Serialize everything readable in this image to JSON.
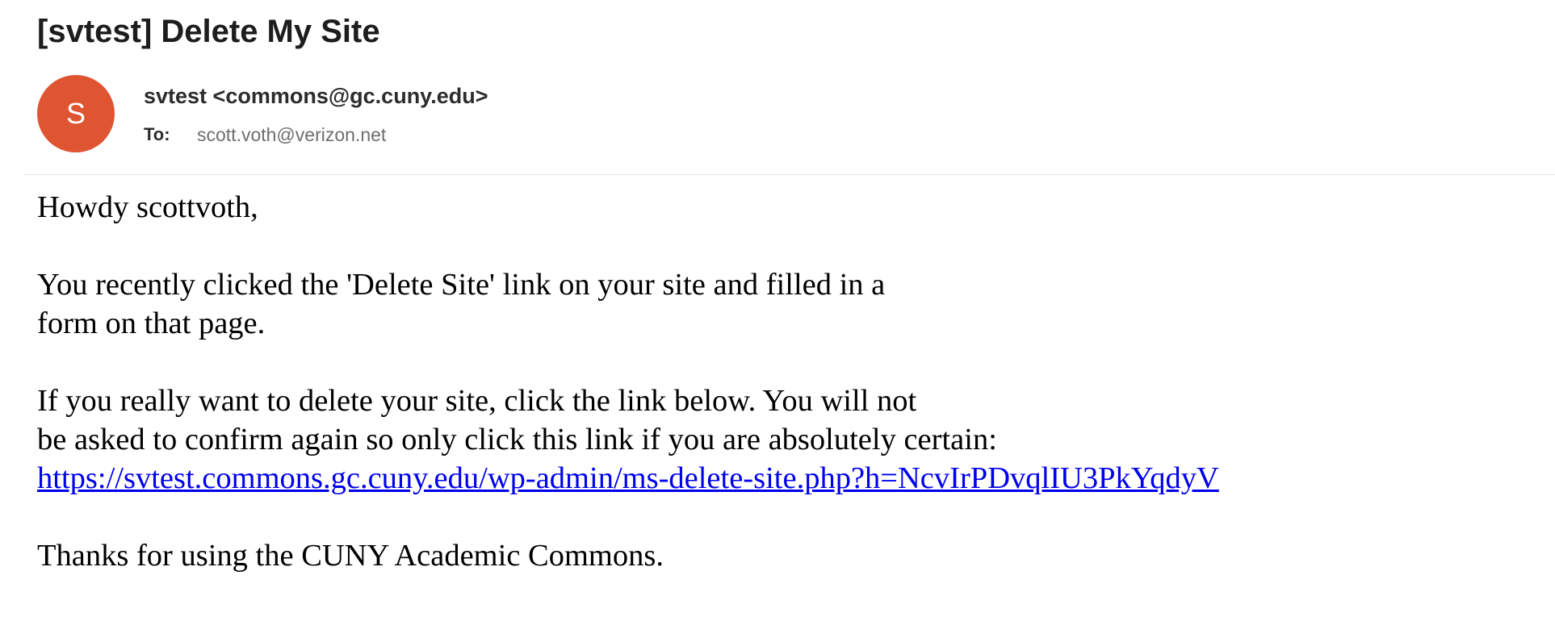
{
  "email": {
    "subject": "[svtest] Delete My Site",
    "avatar": {
      "letter": "S",
      "color": "#df5531"
    },
    "sender": "svtest <commons@gc.cuny.edu>",
    "to_label": "To:",
    "to_address": "scott.voth@verizon.net",
    "body": {
      "greeting": "Howdy scottvoth,",
      "paragraph1_line1": "You recently clicked the 'Delete Site' link on your site and filled in a",
      "paragraph1_line2": "form on that page.",
      "paragraph2_line1": "If you really want to delete your site, click the link below. You will not",
      "paragraph2_line2": "be asked to confirm again so only click this link if you are absolutely certain:",
      "delete_link": "https://svtest.commons.gc.cuny.edu/wp-admin/ms-delete-site.php?h=NcvIrPDvqlIU3PkYqdyV",
      "closing": "Thanks for using the CUNY Academic Commons."
    }
  },
  "colors": {
    "link": "#0000ee",
    "divider": "#e4e4e7",
    "muted_text": "#6e6e73"
  }
}
